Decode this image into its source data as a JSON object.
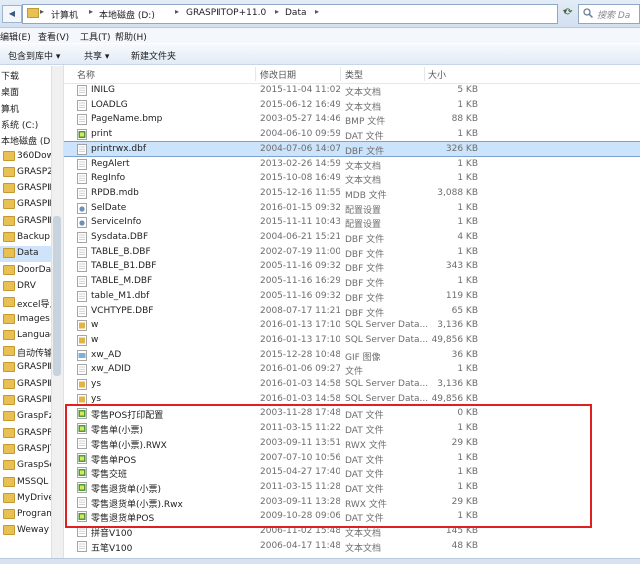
{
  "address": {
    "crumbs": [
      "计算机",
      "本地磁盘 (D:)",
      "GRASPⅡTOP+11.0",
      "Data"
    ],
    "search_placeholder": "搜索 Da"
  },
  "menubar": [
    "编辑(E)",
    "查看(V)",
    "工具(T)",
    "帮助(H)"
  ],
  "toolbar": {
    "include_library": "包含到库中 ▾",
    "share": "共享 ▾",
    "new_folder": "新建文件夹"
  },
  "nav": [
    {
      "label": "下载",
      "kind": "special"
    },
    {
      "label": "桌面",
      "kind": "special"
    },
    {
      "label": "算机",
      "kind": "special"
    },
    {
      "label": "系统 (C:)",
      "kind": "drive"
    },
    {
      "label": "本地磁盘 (D:)",
      "kind": "drive"
    },
    {
      "label": "360Downlo",
      "kind": "folder"
    },
    {
      "label": "GRASP2005",
      "kind": "folder"
    },
    {
      "label": "GRASPⅡ10.",
      "kind": "folder"
    },
    {
      "label": "GRASPⅡTO",
      "kind": "folder"
    },
    {
      "label": "GRASPⅡTO",
      "kind": "folder"
    },
    {
      "label": "Backup",
      "kind": "folder"
    },
    {
      "label": "Data",
      "kind": "folder",
      "selected": true
    },
    {
      "label": "DoorData",
      "kind": "folder"
    },
    {
      "label": "DRV",
      "kind": "folder"
    },
    {
      "label": "excel导入篇",
      "kind": "folder"
    },
    {
      "label": "Images",
      "kind": "folder"
    },
    {
      "label": "Language",
      "kind": "folder"
    },
    {
      "label": "自动传输工",
      "kind": "folder"
    },
    {
      "label": "GRASPⅡTO",
      "kind": "folder"
    },
    {
      "label": "GRASPⅡTO",
      "kind": "folder"
    },
    {
      "label": "GRASPⅡTO",
      "kind": "folder"
    },
    {
      "label": "GraspFzLow",
      "kind": "folder"
    },
    {
      "label": "GRASPPJIT",
      "kind": "folder"
    },
    {
      "label": "GRASPJTO",
      "kind": "folder"
    },
    {
      "label": "GraspServe",
      "kind": "folder"
    },
    {
      "label": "MSSQL",
      "kind": "folder"
    },
    {
      "label": "MyDrivers",
      "kind": "folder"
    },
    {
      "label": "Program File",
      "kind": "folder"
    },
    {
      "label": "Weway",
      "kind": "folder"
    }
  ],
  "columns": {
    "name": "名称",
    "date": "修改日期",
    "type": "类型",
    "size": "大小"
  },
  "files": [
    {
      "name": "INILG",
      "date": "2015-11-04 11:02",
      "type": "文本文档",
      "size": "5 KB",
      "icon": "doc"
    },
    {
      "name": "LOADLG",
      "date": "2015-06-12 16:49",
      "type": "文本文档",
      "size": "1 KB",
      "icon": "doc"
    },
    {
      "name": "PageName.bmp",
      "date": "2003-05-27 14:46",
      "type": "BMP 文件",
      "size": "88 KB",
      "icon": "doc"
    },
    {
      "name": "print",
      "date": "2004-06-10 09:59",
      "type": "DAT 文件",
      "size": "1 KB",
      "icon": "dat"
    },
    {
      "name": "printrwx.dbf",
      "date": "2004-07-06 14:07",
      "type": "DBF 文件",
      "size": "326 KB",
      "icon": "doc",
      "selected": true
    },
    {
      "name": "RegAlert",
      "date": "2013-02-26 14:59",
      "type": "文本文档",
      "size": "1 KB",
      "icon": "doc"
    },
    {
      "name": "RegInfo",
      "date": "2015-10-08 16:49",
      "type": "文本文档",
      "size": "1 KB",
      "icon": "doc"
    },
    {
      "name": "RPDB.mdb",
      "date": "2015-12-16 11:55",
      "type": "MDB 文件",
      "size": "3,088 KB",
      "icon": "doc"
    },
    {
      "name": "SelDate",
      "date": "2016-01-15 09:32",
      "type": "配置设置",
      "size": "1 KB",
      "icon": "cfg"
    },
    {
      "name": "ServiceInfo",
      "date": "2015-11-11 10:43",
      "type": "配置设置",
      "size": "1 KB",
      "icon": "cfg"
    },
    {
      "name": "Sysdata.DBF",
      "date": "2004-06-21 15:21",
      "type": "DBF 文件",
      "size": "4 KB",
      "icon": "doc"
    },
    {
      "name": "TABLE_B.DBF",
      "date": "2002-07-19 11:00",
      "type": "DBF 文件",
      "size": "1 KB",
      "icon": "doc"
    },
    {
      "name": "TABLE_B1.DBF",
      "date": "2005-11-16 09:32",
      "type": "DBF 文件",
      "size": "343 KB",
      "icon": "doc"
    },
    {
      "name": "TABLE_M.DBF",
      "date": "2005-11-16 16:29",
      "type": "DBF 文件",
      "size": "1 KB",
      "icon": "doc"
    },
    {
      "name": "table_M1.dbf",
      "date": "2005-11-16 09:32",
      "type": "DBF 文件",
      "size": "119 KB",
      "icon": "doc"
    },
    {
      "name": "VCHTYPE.DBF",
      "date": "2008-07-17 11:21",
      "type": "DBF 文件",
      "size": "65 KB",
      "icon": "doc"
    },
    {
      "name": "w",
      "date": "2016-01-13 17:10",
      "type": "SQL Server Data...",
      "size": "3,136 KB",
      "icon": "sql"
    },
    {
      "name": "w",
      "date": "2016-01-13 17:10",
      "type": "SQL Server Data...",
      "size": "49,856 KB",
      "icon": "sql"
    },
    {
      "name": "xw_AD",
      "date": "2015-12-28 10:48",
      "type": "GIF 图像",
      "size": "36 KB",
      "icon": "img"
    },
    {
      "name": "xw_ADID",
      "date": "2016-01-06 09:27",
      "type": "文件",
      "size": "1 KB",
      "icon": "doc"
    },
    {
      "name": "ys",
      "date": "2016-01-03 14:58",
      "type": "SQL Server Data...",
      "size": "3,136 KB",
      "icon": "sql"
    },
    {
      "name": "ys",
      "date": "2016-01-03 14:58",
      "type": "SQL Server Data...",
      "size": "49,856 KB",
      "icon": "sql"
    },
    {
      "name": "零售POS打印配置",
      "date": "2003-11-28 17:48",
      "type": "DAT 文件",
      "size": "0 KB",
      "icon": "dat"
    },
    {
      "name": "零售单(小票)",
      "date": "2011-03-15 11:22",
      "type": "DAT 文件",
      "size": "1 KB",
      "icon": "dat"
    },
    {
      "name": "零售单(小票).RWX",
      "date": "2003-09-11 13:51",
      "type": "RWX 文件",
      "size": "29 KB",
      "icon": "doc"
    },
    {
      "name": "零售单POS",
      "date": "2007-07-10 10:56",
      "type": "DAT 文件",
      "size": "1 KB",
      "icon": "dat"
    },
    {
      "name": "零售交班",
      "date": "2015-04-27 17:40",
      "type": "DAT 文件",
      "size": "1 KB",
      "icon": "dat"
    },
    {
      "name": "零售退货单(小票)",
      "date": "2011-03-15 11:28",
      "type": "DAT 文件",
      "size": "1 KB",
      "icon": "dat"
    },
    {
      "name": "零售退货单(小票).Rwx",
      "date": "2003-09-11 13:28",
      "type": "RWX 文件",
      "size": "29 KB",
      "icon": "doc"
    },
    {
      "name": "零售退货单POS",
      "date": "2009-10-28 09:06",
      "type": "DAT 文件",
      "size": "1 KB",
      "icon": "dat"
    },
    {
      "name": "拼音V100",
      "date": "2006-11-02 15:48",
      "type": "文本文档",
      "size": "145 KB",
      "icon": "doc"
    },
    {
      "name": "五笔V100",
      "date": "2006-04-17 11:48",
      "type": "文本文档",
      "size": "48 KB",
      "icon": "doc"
    }
  ],
  "colors": {
    "highlight": "#e02020",
    "selection": "#cce4fb",
    "folder": "#e8c054"
  }
}
